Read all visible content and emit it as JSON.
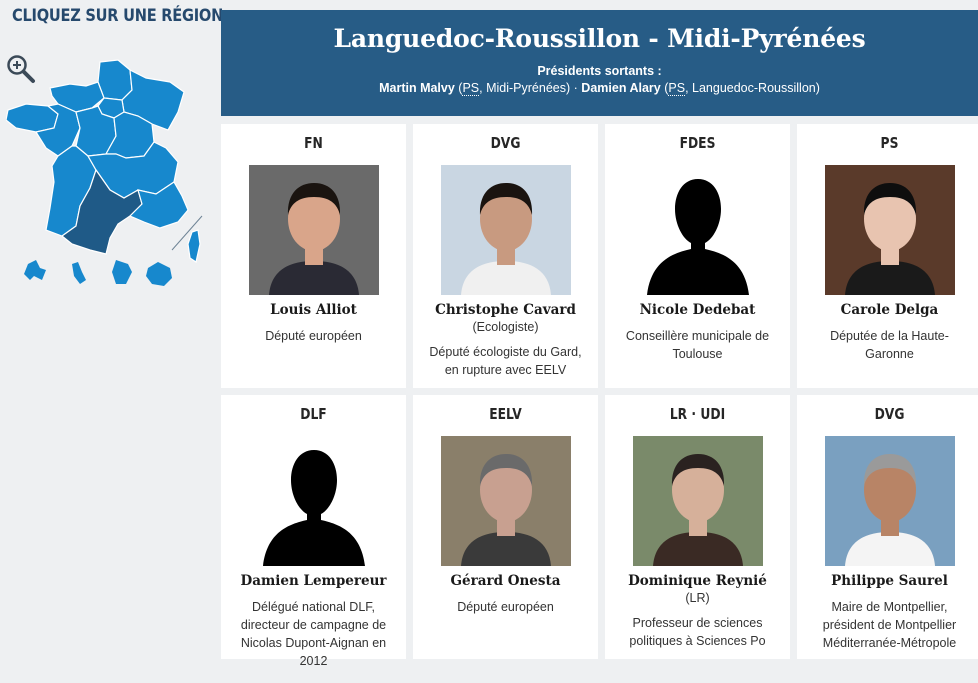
{
  "sidebar": {
    "title": "CLIQUEZ SUR UNE RÉGION"
  },
  "header": {
    "region": "Languedoc-Roussillon - Midi-Pyrénées",
    "presidents_label": "Présidents sortants :",
    "president1_name": "Martin Malvy",
    "president1_party": "PS",
    "president1_region": ", Midi-Pyrénées)",
    "separator": "·",
    "president2_name": "Damien Alary",
    "president2_party": "PS",
    "president2_region": ", Languedoc-Roussillon)"
  },
  "candidates": [
    {
      "party": "FN",
      "name": "Louis Alliot",
      "affiliation": "",
      "description": "Député européen",
      "photo": "photo-portrait"
    },
    {
      "party": "DVG",
      "name": "Christophe Cavard",
      "affiliation": "(Ecologiste)",
      "description": "Député écologiste du Gard, en rupture avec EELV",
      "photo": "photo-portrait"
    },
    {
      "party": "FDES",
      "name": "Nicole Dedebat",
      "affiliation": "",
      "description": "Conseillère municipale de Toulouse",
      "photo": "placeholder-silhouette"
    },
    {
      "party": "PS",
      "name": "Carole Delga",
      "affiliation": "",
      "description": "Députée de la Haute-Garonne",
      "photo": "photo-portrait"
    },
    {
      "party": "DLF",
      "name": "Damien Lempereur",
      "affiliation": "",
      "description": "Délégué national DLF, directeur de campagne de Nicolas Dupont-Aignan en 2012",
      "photo": "placeholder-silhouette"
    },
    {
      "party": "EELV",
      "name": "Gérard Onesta",
      "affiliation": "",
      "description": "Député européen",
      "photo": "photo-portrait"
    },
    {
      "party": "LR · UDI",
      "name": "Dominique Reynié",
      "affiliation": "(LR)",
      "description": "Professeur de sciences politiques à Sciences Po",
      "photo": "photo-portrait"
    },
    {
      "party": "DVG",
      "name": "Philippe Saurel",
      "affiliation": "",
      "description": "Maire de Montpellier, président de Montpellier Méditerranée-Métropole",
      "photo": "photo-portrait"
    }
  ],
  "colors": {
    "header_bg": "#275c86",
    "map_region": "#1788cd",
    "map_selected": "#1f5a87",
    "sidebar_title": "#26496d"
  },
  "icons": {
    "zoom": "zoom-in-icon"
  }
}
